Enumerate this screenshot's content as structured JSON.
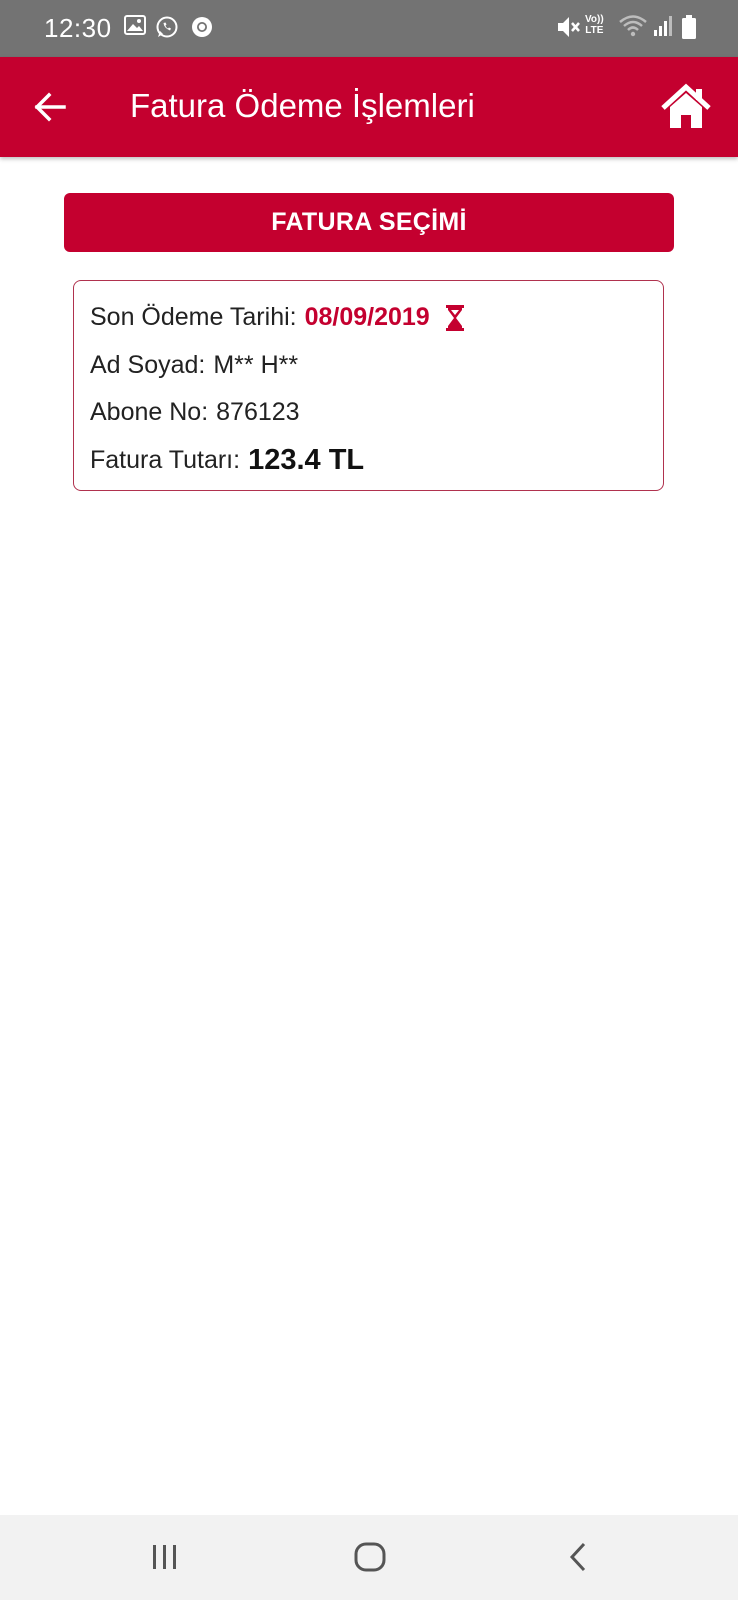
{
  "status_bar": {
    "time": "12:30",
    "network_label_top": "Vo))",
    "network_label_bottom": "LTE",
    "icons": [
      "image-icon",
      "whatsapp-icon",
      "chrome-icon",
      "mute-icon",
      "wifi-icon",
      "signal-icon",
      "battery-icon"
    ]
  },
  "app_bar": {
    "title": "Fatura Ödeme İşlemleri",
    "back_icon": "arrow-left-icon",
    "home_icon": "home-icon"
  },
  "section": {
    "label": "FATURA SEÇİMİ"
  },
  "bill": {
    "due_date_label": "Son Ödeme Tarihi:",
    "due_date_value": "08/09/2019",
    "due_icon": "hourglass-icon",
    "name_label": "Ad Soyad:",
    "name_value": "M** H**",
    "subscriber_label": "Abone No:",
    "subscriber_value": "876123",
    "amount_label": "Fatura Tutarı:",
    "amount_value": "123.4 TL"
  },
  "nav_bar": {
    "icons": [
      "recents-icon",
      "home-circle-icon",
      "back-chevron-icon"
    ]
  },
  "colors": {
    "brand": "#c4002f",
    "status_bar": "#737373",
    "nav_bar": "#f2f2f2"
  }
}
